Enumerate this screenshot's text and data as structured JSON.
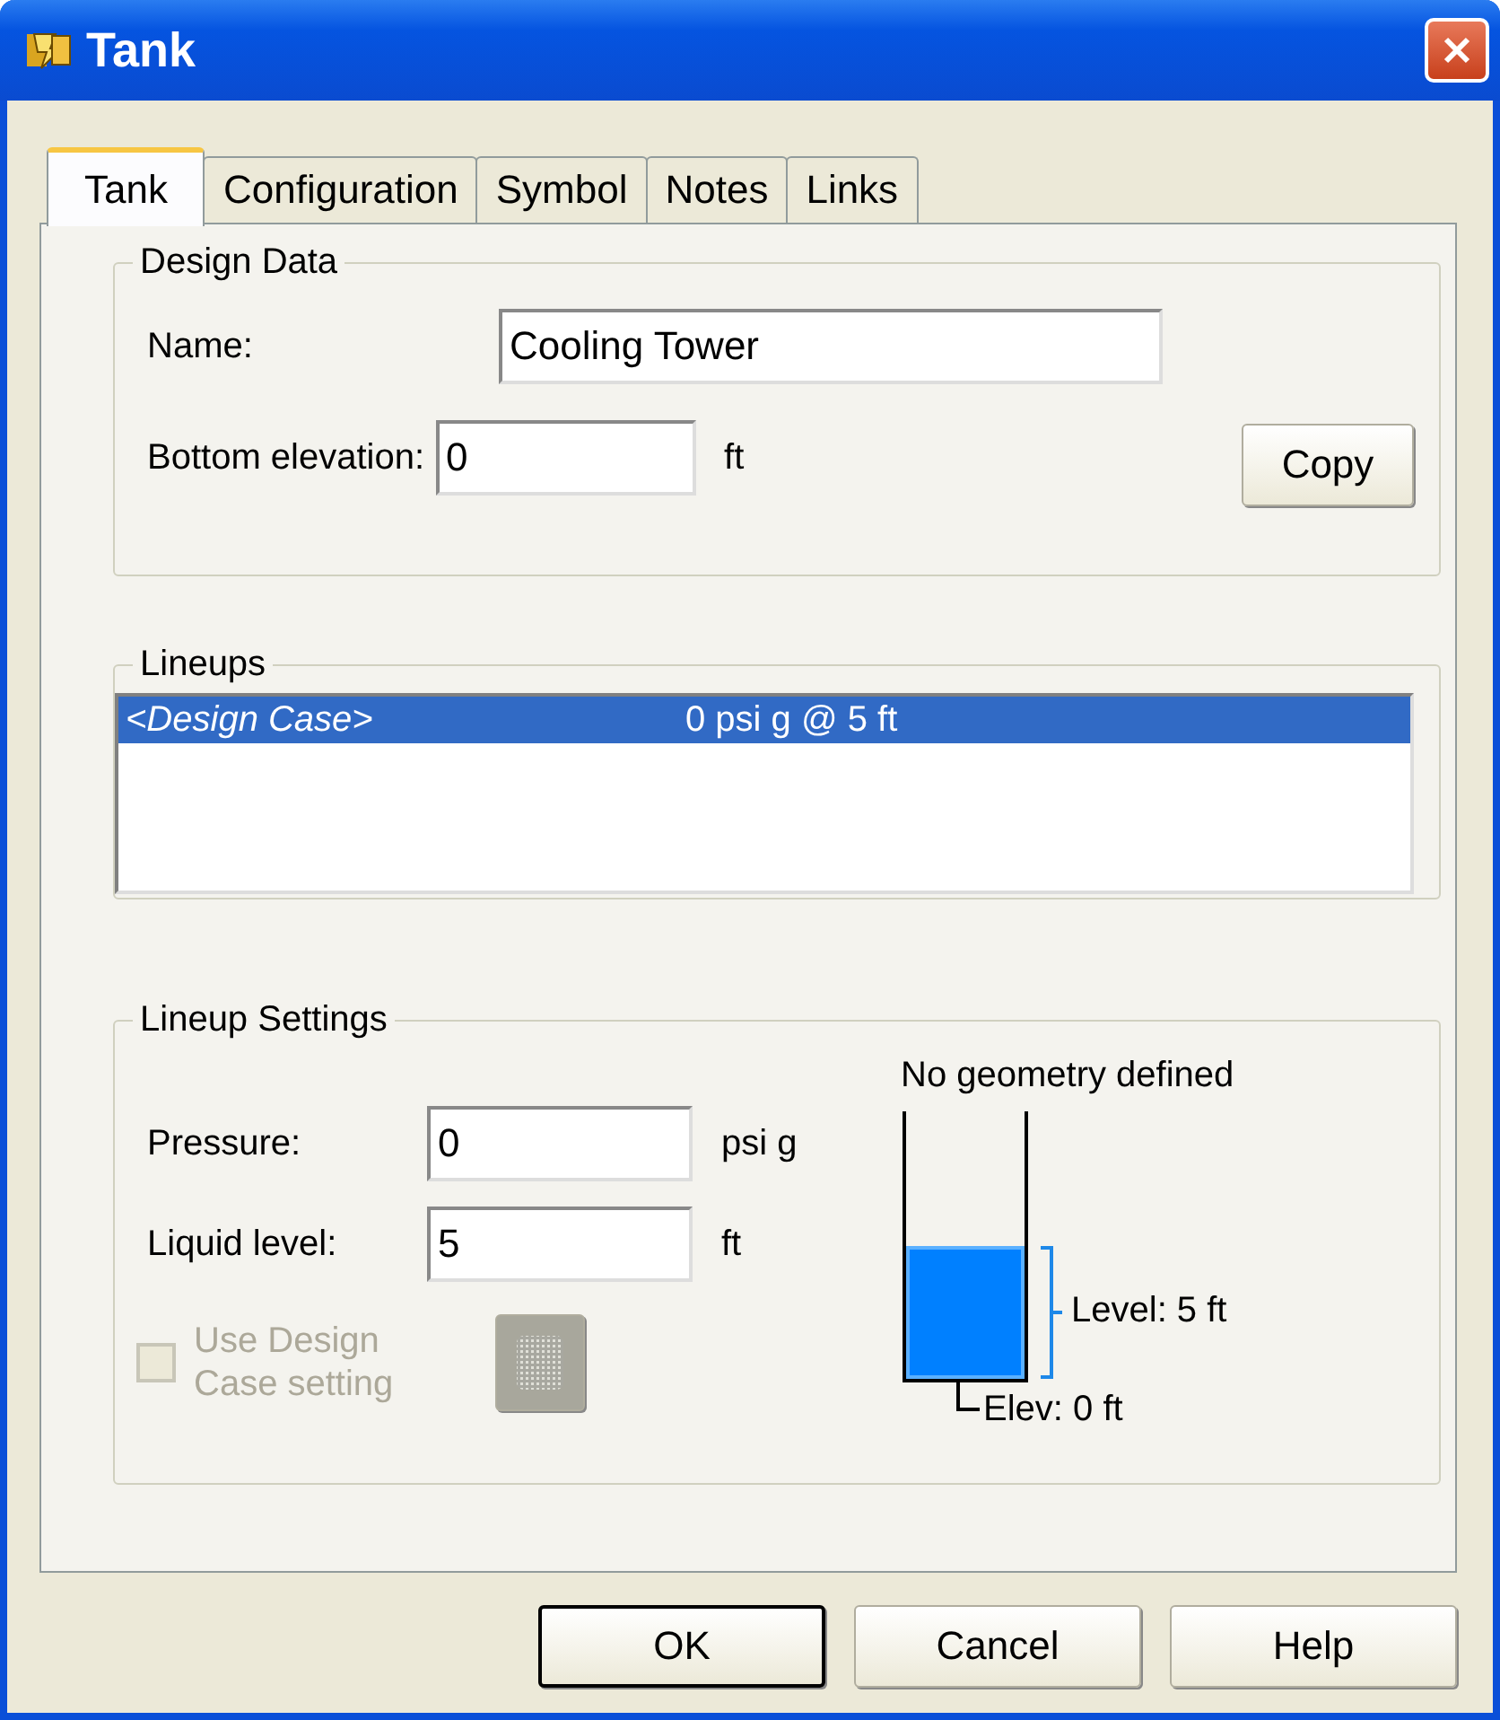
{
  "window": {
    "title": "Tank"
  },
  "tabs": [
    {
      "label": "Tank",
      "selected": true
    },
    {
      "label": "Configuration",
      "selected": false
    },
    {
      "label": "Symbol",
      "selected": false
    },
    {
      "label": "Notes",
      "selected": false
    },
    {
      "label": "Links",
      "selected": false
    }
  ],
  "design_data": {
    "title": "Design Data",
    "name_label": "Name:",
    "name_value": "Cooling Tower",
    "elevation_label": "Bottom elevation:",
    "elevation_value": "0",
    "elevation_unit": "ft",
    "copy_button": "Copy"
  },
  "lineups": {
    "title": "Lineups",
    "rows": [
      {
        "case": "<Design Case>",
        "value": "0 psi g @ 5 ft",
        "selected": true
      }
    ]
  },
  "lineup_settings": {
    "title": "Lineup Settings",
    "pressure_label": "Pressure:",
    "pressure_value": "0",
    "pressure_unit": "psi g",
    "liquid_label": "Liquid level:",
    "liquid_value": "5",
    "liquid_unit": "ft",
    "use_design": {
      "label": "Use Design Case setting",
      "checked": false,
      "disabled": true
    },
    "diagram": {
      "caption": "No geometry defined",
      "level_label": "Level: 5 ft",
      "elev_label": "Elev: 0 ft"
    }
  },
  "buttons": [
    "OK",
    "Cancel",
    "Help"
  ]
}
